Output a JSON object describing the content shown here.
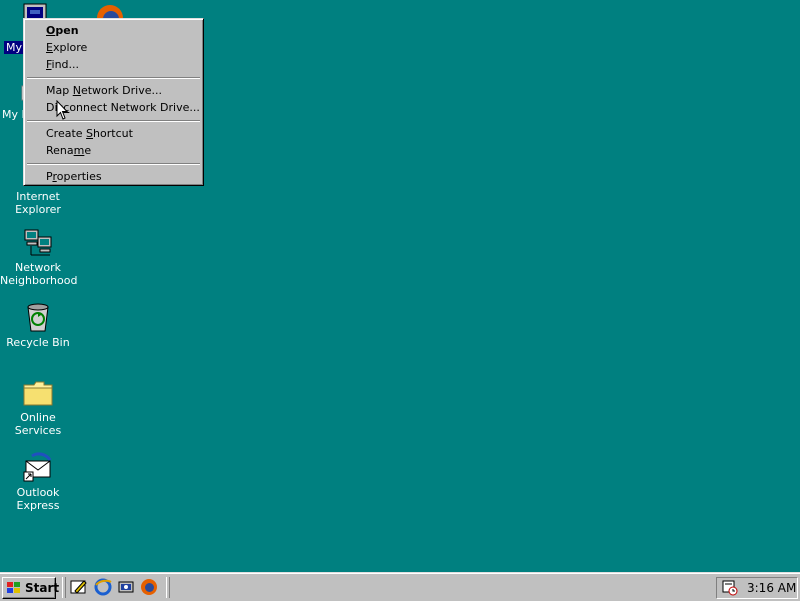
{
  "desktop": {
    "icons": [
      {
        "label": "My Computer",
        "visible_label": "My"
      },
      {
        "label": "My D",
        "visible_label": "My D"
      },
      {
        "label": "Internet Explorer",
        "line1": "Internet",
        "line2": "Explorer"
      },
      {
        "label": "Network Neighborhood",
        "line1": "Network",
        "line2": "Neighborhood"
      },
      {
        "label": "Recycle Bin",
        "line1": "Recycle Bin"
      },
      {
        "label": "Online Services",
        "line1": "Online",
        "line2": "Services"
      },
      {
        "label": "Outlook Express",
        "line1": "Outlook",
        "line2": "Express"
      }
    ]
  },
  "context_menu": {
    "items": [
      {
        "pre": "",
        "mn": "O",
        "post": "pen",
        "bold": true
      },
      {
        "pre": "",
        "mn": "E",
        "post": "xplore"
      },
      {
        "pre": "",
        "mn": "F",
        "post": "ind..."
      },
      {
        "pre": "Map ",
        "mn": "N",
        "post": "etwork Drive..."
      },
      {
        "pre": "Dis",
        "mn": "c",
        "post": "onnect Network Drive..."
      },
      {
        "pre": "Create ",
        "mn": "S",
        "post": "hortcut"
      },
      {
        "pre": "Rena",
        "mn": "m",
        "post": "e"
      },
      {
        "pre": "P",
        "mn": "r",
        "post": "operties"
      }
    ]
  },
  "taskbar": {
    "start_label": "Start",
    "quick_launch": [
      "desktop-edit-icon",
      "internet-explorer-icon",
      "channels-icon",
      "firefox-icon"
    ],
    "clock": "3:16 AM"
  },
  "colors": {
    "desktop": "#008080",
    "face": "#c0c0c0",
    "selection": "#000080"
  }
}
